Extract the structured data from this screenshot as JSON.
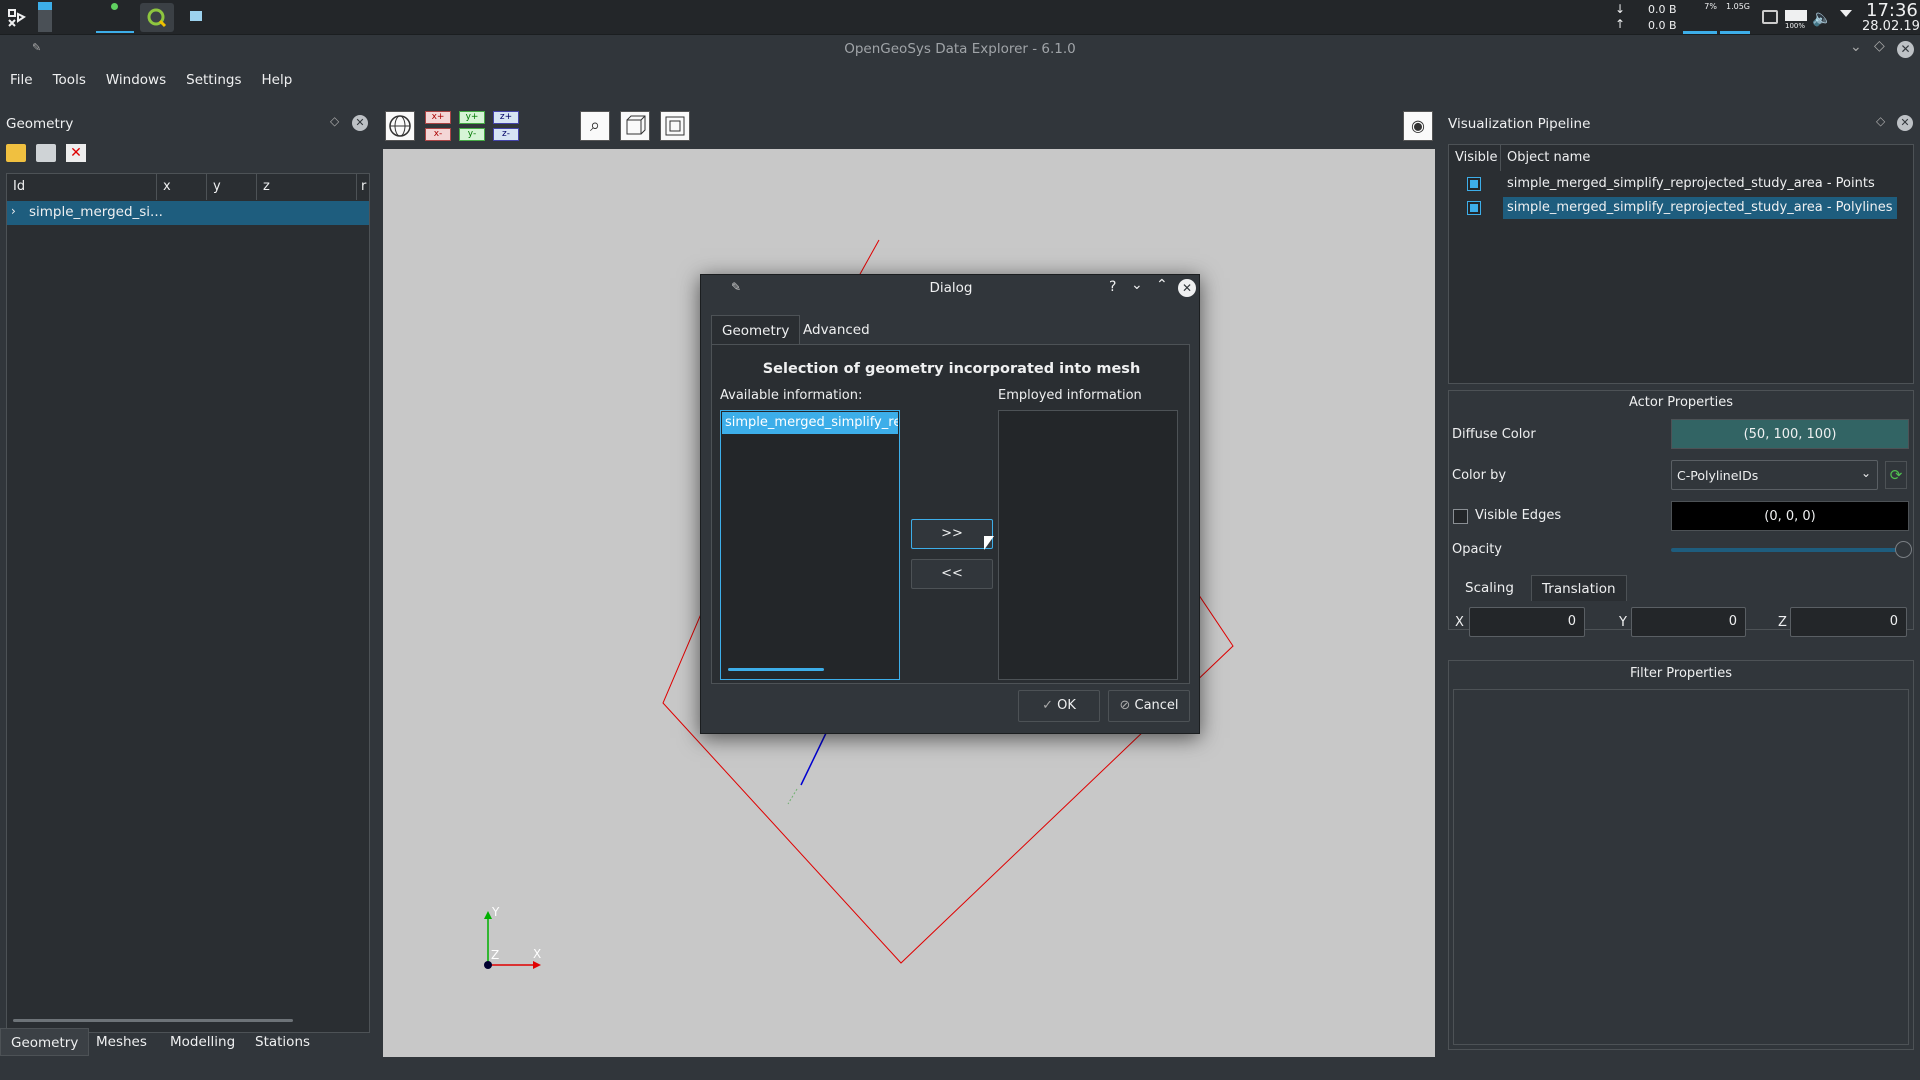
{
  "taskbar": {
    "net_down": "0.0 B",
    "net_up": "0.0 B",
    "cpu": "7%",
    "mem": "1.05G",
    "battery": "100%",
    "time": "17:36",
    "date": "28.02.19"
  },
  "window": {
    "title": "OpenGeoSys Data Explorer - 6.1.0"
  },
  "menu": [
    "File",
    "Tools",
    "Windows",
    "Settings",
    "Help"
  ],
  "geometry_panel": {
    "title": "Geometry",
    "columns": [
      "Id",
      "x",
      "y",
      "z",
      "r"
    ],
    "rows": [
      {
        "label": "simple_merged_si..."
      }
    ],
    "bottom_tabs": [
      "Geometry",
      "Meshes",
      "Modelling",
      "Stations"
    ]
  },
  "toolbar": {
    "icons": [
      "globe-icon",
      "add-x-icon",
      "add-y-icon",
      "add-z-icon",
      "sub-x-icon",
      "sub-y-icon",
      "sub-z-icon",
      "zoom-icon",
      "perspective-icon",
      "ortho-icon",
      "screenshot-icon"
    ]
  },
  "viewport": {
    "axis_x": "X",
    "axis_y": "Y",
    "axis_z": "Z"
  },
  "pipeline": {
    "title": "Visualization Pipeline",
    "col_visible": "Visible",
    "col_name": "Object name",
    "rows": [
      {
        "name": "simple_merged_simplify_reprojected_study_area - Points",
        "checked": true
      },
      {
        "name": "simple_merged_simplify_reprojected_study_area - Polylines",
        "checked": true
      }
    ],
    "actor_title": "Actor Properties",
    "diffuse_label": "Diffuse Color",
    "diffuse_value": "(50, 100, 100)",
    "colorby_label": "Color by",
    "colorby_value": "C-PolylineIDs",
    "edges_label": "Visible Edges",
    "edges_value": "(0, 0, 0)",
    "opacity_label": "Opacity",
    "tab_scaling": "Scaling",
    "tab_translation": "Translation",
    "x_label": "X",
    "x_value": "0",
    "y_label": "Y",
    "y_value": "0",
    "z_label": "Z",
    "z_value": "0",
    "filter_title": "Filter Properties"
  },
  "dialog": {
    "title": "Dialog",
    "tab_geometry": "Geometry",
    "tab_advanced": "Advanced",
    "heading": "Selection of geometry incorporated into mesh",
    "available_label": "Available information:",
    "employed_label": "Employed information",
    "available_items": [
      "simple_merged_simplify_repr"
    ],
    "add_label": ">>",
    "remove_label": "<<",
    "ok_label": "OK",
    "cancel_label": "Cancel"
  },
  "colors": {
    "accent": "#3daee9",
    "selection": "#1e5d7e",
    "diffuse": "#326464"
  }
}
